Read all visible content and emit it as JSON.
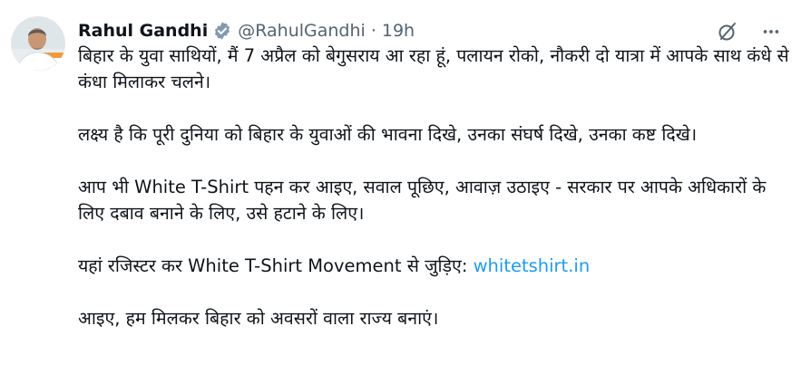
{
  "author": {
    "display_name": "Rahul Gandhi",
    "handle": "@RahulGandhi",
    "separator": "·",
    "time": "19h",
    "verified_color": "#829aab"
  },
  "actions": [
    {
      "icon": "grok-icon"
    },
    {
      "icon": "more-icon"
    }
  ],
  "tweet": {
    "para1": "बिहार के युवा साथियों, मैं 7 अप्रैल को बेगुसराय आ रहा हूं, पलायन रोको, नौकरी दो यात्रा में आपके साथ कंधे से कंधा मिलाकर चलने।",
    "para2": "लक्ष्य है कि पूरी दुनिया को बिहार के युवाओं की भावना दिखे, उनका संघर्ष दिखे, उनका कष्ट दिखे।",
    "para3": "आप भी White T-Shirt पहन कर आइए, सवाल पूछिए, आवाज़ उठाइए - सरकार पर आपके अधिकारों के लिए दबाव बनाने के लिए, उसे हटाने के लिए।",
    "para4_prefix": "यहां रजिस्टर कर White T-Shirt Movement से जुड़िए: ",
    "para4_link": "whitetshirt.in",
    "para5": "आइए, हम मिलकर बिहार को अवसरों वाला राज्य बनाएं।"
  },
  "colors": {
    "text": "#0f1419",
    "secondary": "#536471",
    "link": "#1d9bf0"
  }
}
